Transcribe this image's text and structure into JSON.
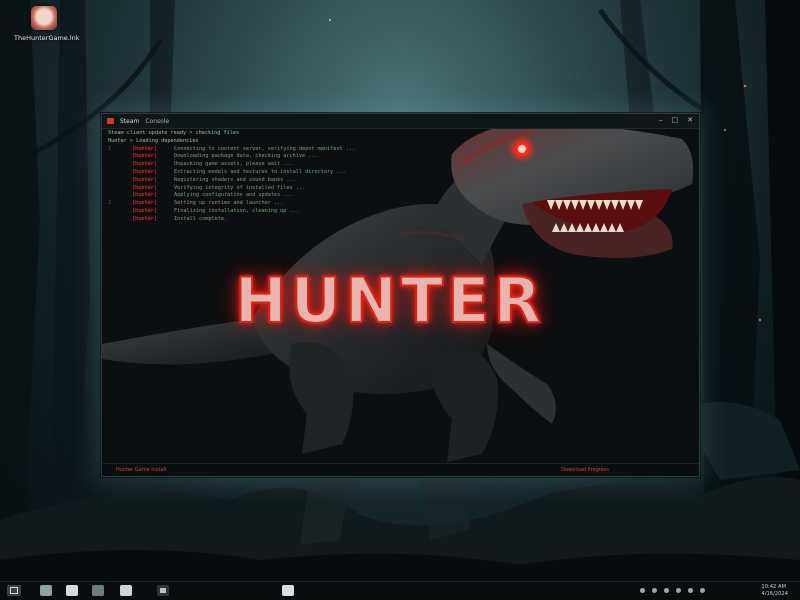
{
  "desktop": {
    "icon_label": "TheHunterGame.lnk"
  },
  "window": {
    "tab_title": "Steam",
    "tab_title2": "Console",
    "controls": {
      "minimize": "–",
      "maximize": "□",
      "close": "✕"
    },
    "art_title": "HUNTER",
    "status_left": "Hunter Game Install",
    "status_right": "Download Progress"
  },
  "terminal": {
    "header_line1": "Steam client update ready > checking files",
    "header_line2": "Hunter > Loading dependencies",
    "rows": [
      {
        "gutter": "1",
        "tag": "[hunter]",
        "text": "Connecting to content server, verifying depot manifest ..."
      },
      {
        "gutter": "",
        "tag": "[hunter]",
        "text": "Downloading package data, checking archive ..."
      },
      {
        "gutter": "",
        "tag": "[hunter]",
        "text": "Unpacking game assets, please wait ..."
      },
      {
        "gutter": "",
        "tag": "[hunter]",
        "text": "Extracting models and textures to install directory ..."
      },
      {
        "gutter": "",
        "tag": "[hunter]",
        "text": "Registering shaders and sound banks ..."
      },
      {
        "gutter": "",
        "tag": "[hunter]",
        "text": "Verifying integrity of installed files ..."
      },
      {
        "gutter": "",
        "tag": "[hunter]",
        "text": "Applying configuration and updates ..."
      },
      {
        "gutter": "2",
        "tag": "[hunter]",
        "text": "Setting up runtime and launcher ..."
      },
      {
        "gutter": "",
        "tag": "[hunter]",
        "text": "Finalizing installation, cleaning up ..."
      },
      {
        "gutter": "",
        "tag": "[hunter]",
        "text": "Install complete."
      }
    ]
  },
  "taskbar": {
    "clock_time": "10:42 AM",
    "clock_date": "4/16/2024"
  },
  "colors": {
    "accent_red": "#d3261c",
    "terminal_green": "#7cbf88",
    "window_bg": "#0c0f11"
  }
}
